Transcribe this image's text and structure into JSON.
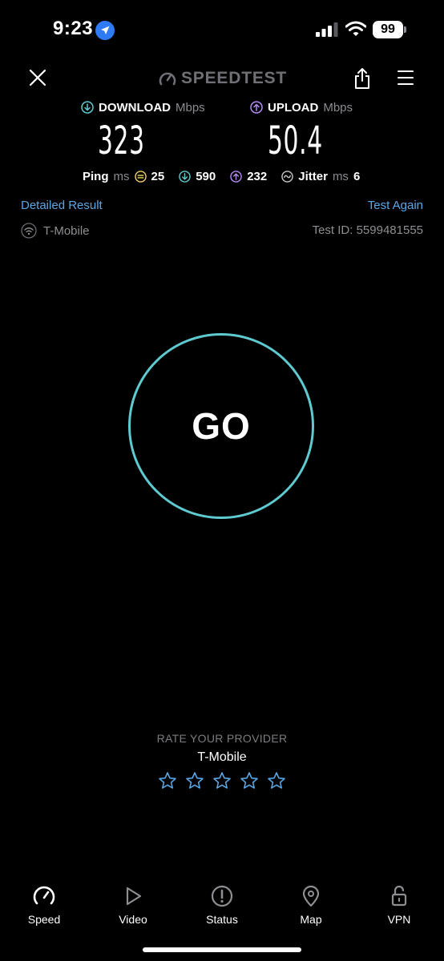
{
  "status_bar": {
    "time": "9:23",
    "battery": "99"
  },
  "header": {
    "brand": "SPEEDTEST"
  },
  "results": {
    "download": {
      "label": "DOWNLOAD",
      "unit": "Mbps",
      "value": "323"
    },
    "upload": {
      "label": "UPLOAD",
      "unit": "Mbps",
      "value": "50.4"
    },
    "ping": {
      "label": "Ping",
      "unit": "ms",
      "idle": "25",
      "download": "590",
      "upload": "232",
      "jitter_label": "Jitter",
      "jitter_unit": "ms",
      "jitter": "6"
    },
    "detailed_link": "Detailed Result",
    "test_again_link": "Test Again",
    "provider": "T-Mobile",
    "test_id": "Test ID: 5599481555"
  },
  "go_button": {
    "label": "GO"
  },
  "rating": {
    "title": "RATE YOUR PROVIDER",
    "provider": "T-Mobile",
    "max_stars": 5
  },
  "tabs": [
    {
      "label": "Speed",
      "icon": "speedometer-icon"
    },
    {
      "label": "Video",
      "icon": "play-icon"
    },
    {
      "label": "Status",
      "icon": "alert-icon"
    },
    {
      "label": "Map",
      "icon": "map-pin-icon"
    },
    {
      "label": "VPN",
      "icon": "unlock-icon"
    }
  ],
  "colors": {
    "accent_cyan": "#5ec9cf",
    "link_blue": "#5aa7e6",
    "upload_purple": "#b38bf2",
    "ping_yellow": "#f2d26b"
  }
}
